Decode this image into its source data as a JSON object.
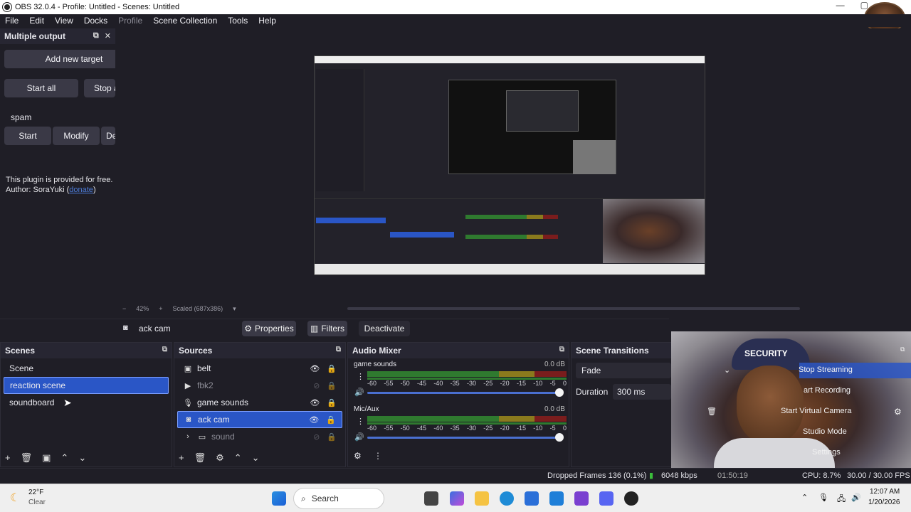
{
  "window": {
    "title": "OBS 32.0.4 - Profile: Untitled - Scenes: Untitled"
  },
  "menu": {
    "items": [
      "File",
      "Edit",
      "View",
      "Docks",
      "Profile",
      "Scene Collection",
      "Tools",
      "Help"
    ]
  },
  "multiple_output": {
    "title": "Multiple output",
    "add_target": "Add new target",
    "start_all": "Start all",
    "stop_all": "Stop a",
    "target_name": "spam",
    "start": "Start",
    "modify": "Modify",
    "delete": "De",
    "notice_line1": "This plugin is provided for free.",
    "notice_author_prefix": "Author: SoraYuki (",
    "donate": "donate",
    "notice_author_suffix": ")"
  },
  "preview_bar": {
    "zoom": "42%",
    "scaled": "Scaled (687x386)"
  },
  "context_bar": {
    "source": "ack cam",
    "properties": "Properties",
    "filters": "Filters",
    "deactivate": "Deactivate"
  },
  "scenes": {
    "title": "Scenes",
    "items": [
      "Scene",
      "reaction scene",
      "soundboard"
    ],
    "selected_index": 1
  },
  "sources": {
    "title": "Sources",
    "items": [
      {
        "name": "belt",
        "icon": "image-icon",
        "visible": true,
        "dim": false
      },
      {
        "name": "fbk2",
        "icon": "play-icon",
        "visible": false,
        "dim": true
      },
      {
        "name": "game sounds",
        "icon": "mic-icon",
        "visible": true,
        "dim": false
      },
      {
        "name": "ack cam",
        "icon": "camera-icon",
        "visible": true,
        "dim": false
      },
      {
        "name": "sound",
        "icon": "folder-icon",
        "visible": false,
        "dim": true
      }
    ],
    "selected_index": 3
  },
  "audio_mixer": {
    "title": "Audio Mixer",
    "channels": [
      {
        "name": "game sounds",
        "level": "0.0 dB"
      },
      {
        "name": "Mic/Aux",
        "level": "0.0 dB"
      }
    ],
    "ticks": [
      "-60",
      "-55",
      "-50",
      "-45",
      "-40",
      "-35",
      "-30",
      "-25",
      "-20",
      "-15",
      "-10",
      "-5",
      "0"
    ]
  },
  "scene_transitions": {
    "title": "Scene Transitions",
    "transition": "Fade",
    "duration_label": "Duration",
    "duration_value": "300 ms"
  },
  "controls": {
    "stop_streaming": "Stop Streaming",
    "start_recording": "art Recording",
    "start_virtual_camera": "Start Virtual Camera",
    "studio_mode": "Studio Mode",
    "settings": "Settings",
    "webcam_cap_text": "SECURITY"
  },
  "status": {
    "dropped_frames": "Dropped Frames 136 (0.1%)",
    "bitrate": "6048 kbps",
    "stream_time": "01:50:19",
    "cpu": "CPU: 8.7%",
    "fps": "30.00 / 30.00 FPS"
  },
  "taskbar": {
    "temperature": "22°F",
    "weather": "Clear",
    "search": "Search",
    "time": "12:07 AM",
    "date": "1/20/2026"
  },
  "colors": {
    "accent": "#2a56c6",
    "panel": "#1f1e26",
    "panel_header": "#272632",
    "button": "#3a3946"
  }
}
